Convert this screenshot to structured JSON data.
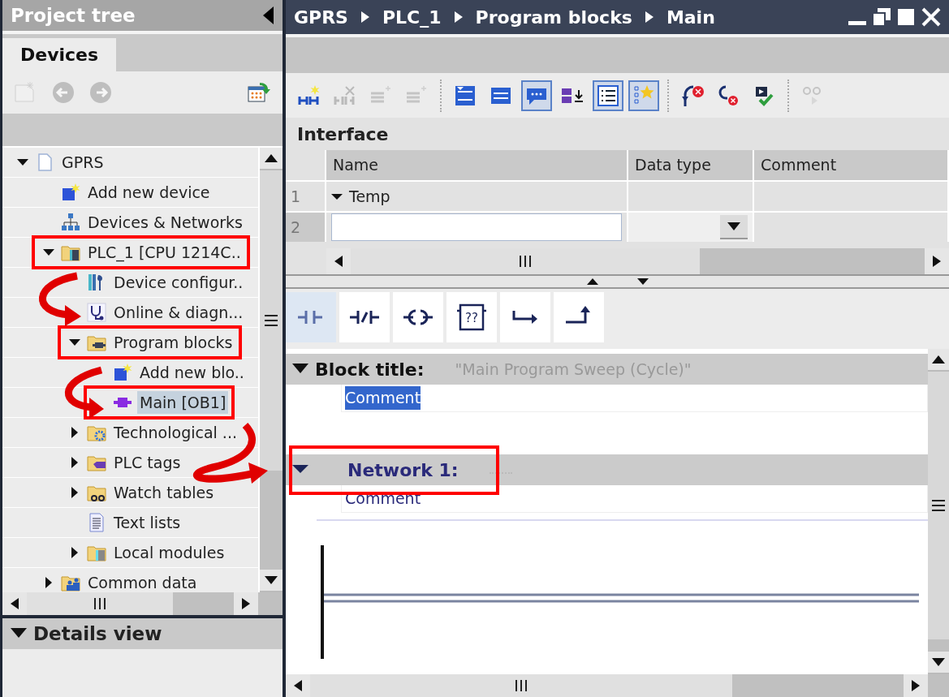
{
  "project_tree": {
    "title": "Project tree",
    "tabs": [
      {
        "label": "Devices",
        "selected": true
      }
    ],
    "toolbar": [
      {
        "kind": "new-group",
        "disabled": true
      },
      {
        "kind": "back",
        "disabled": true
      },
      {
        "kind": "forward",
        "disabled": true
      },
      {
        "kind": "overview",
        "disabled": false
      }
    ],
    "items": [
      {
        "label": "GPRS",
        "kind": "project",
        "expanded": true,
        "selected": false,
        "highlighted": false,
        "children": [
          {
            "label": "Add new device",
            "kind": "add",
            "selected": false,
            "highlighted": false
          },
          {
            "label": "Devices & Networks",
            "kind": "network",
            "selected": false,
            "highlighted": false
          },
          {
            "label": "PLC_1 [CPU 1214C..",
            "kind": "plc",
            "expanded": true,
            "selected": false,
            "highlighted": true,
            "children": [
              {
                "label": "Device configur..",
                "kind": "config",
                "selected": false,
                "highlighted": false
              },
              {
                "label": "Online & diagn...",
                "kind": "diagnostics",
                "selected": false,
                "highlighted": false
              },
              {
                "label": "Program blocks",
                "kind": "folder-blocks",
                "expanded": true,
                "selected": false,
                "highlighted": true,
                "children": [
                  {
                    "label": "Add new blo..",
                    "kind": "add",
                    "selected": false,
                    "highlighted": false
                  },
                  {
                    "label": "Main [OB1]",
                    "kind": "block",
                    "selected": true,
                    "highlighted": true
                  }
                ]
              },
              {
                "label": "Technological ...",
                "kind": "folder-tech",
                "expanded": false,
                "selected": false,
                "highlighted": false
              },
              {
                "label": "PLC tags",
                "kind": "folder-tags",
                "expanded": false,
                "selected": false,
                "highlighted": false
              },
              {
                "label": "Watch tables",
                "kind": "folder-watch",
                "expanded": false,
                "selected": false,
                "highlighted": false
              },
              {
                "label": "Text lists",
                "kind": "text-list",
                "selected": false,
                "highlighted": false
              },
              {
                "label": "Local modules",
                "kind": "folder-modules",
                "expanded": false,
                "selected": false,
                "highlighted": false
              }
            ]
          },
          {
            "label": "Common data",
            "kind": "folder-common",
            "expanded": false,
            "selected": false,
            "highlighted": false
          }
        ]
      }
    ]
  },
  "details_view": {
    "title": "Details view",
    "expanded": true
  },
  "editor": {
    "breadcrumb": [
      "GPRS",
      "PLC_1",
      "Program blocks",
      "Main"
    ],
    "toolbar": [
      {
        "kind": "insert-network",
        "disabled": false,
        "pressed": false
      },
      {
        "kind": "delete-network",
        "disabled": true,
        "pressed": false
      },
      {
        "kind": "insert-row",
        "disabled": true,
        "pressed": false
      },
      {
        "kind": "add-row",
        "disabled": true,
        "pressed": false
      },
      {
        "kind": "sep"
      },
      {
        "kind": "open-all",
        "disabled": false,
        "pressed": false
      },
      {
        "kind": "close-all",
        "disabled": false,
        "pressed": false
      },
      {
        "kind": "comments",
        "disabled": false,
        "pressed": true
      },
      {
        "kind": "tags",
        "disabled": false,
        "pressed": false
      },
      {
        "kind": "list",
        "disabled": false,
        "pressed": true
      },
      {
        "kind": "favorites",
        "disabled": false,
        "pressed": true
      },
      {
        "kind": "sep"
      },
      {
        "kind": "call-error",
        "disabled": false,
        "pressed": false
      },
      {
        "kind": "jump-error",
        "disabled": false,
        "pressed": false
      },
      {
        "kind": "compile",
        "disabled": false,
        "pressed": false
      },
      {
        "kind": "sep"
      },
      {
        "kind": "monitor",
        "disabled": true,
        "pressed": false
      }
    ],
    "interface": {
      "title": "Interface",
      "columns": [
        "Name",
        "Data type",
        "Comment"
      ],
      "rows": [
        {
          "number": "1",
          "kind": "section",
          "name": "Temp",
          "expanded": true
        },
        {
          "number": "2",
          "kind": "new"
        }
      ]
    },
    "palette": [
      {
        "kind": "contact",
        "selected": true
      },
      {
        "kind": "nc-contact",
        "selected": false
      },
      {
        "kind": "coil",
        "selected": false
      },
      {
        "kind": "box",
        "label": "??",
        "selected": false
      },
      {
        "kind": "open-branch",
        "selected": false
      },
      {
        "kind": "close-branch",
        "selected": false
      }
    ],
    "block": {
      "label": "Block title:",
      "title": "\"Main Program Sweep (Cycle)\"",
      "expanded": true,
      "comment": "Comment",
      "comment_selected": true
    },
    "networks": [
      {
        "label": "Network 1:",
        "expanded": true,
        "highlighted": true,
        "comment": "Comment"
      }
    ]
  }
}
